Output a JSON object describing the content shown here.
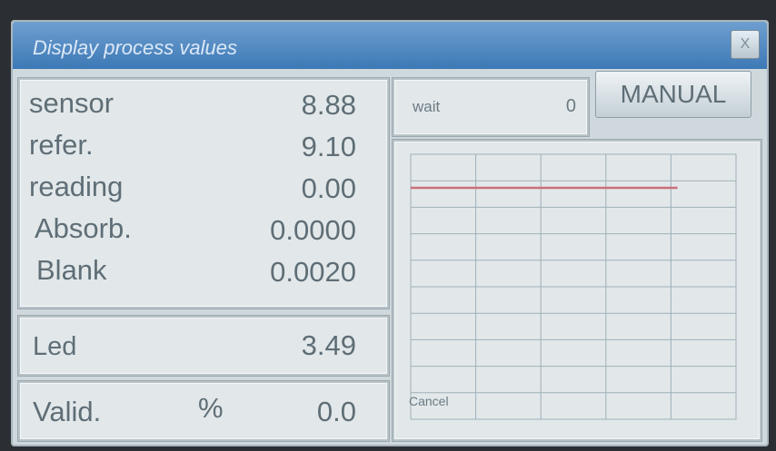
{
  "window": {
    "title": "Display process values",
    "close_label": "X"
  },
  "values": [
    {
      "label": "sensor",
      "value": "8.88"
    },
    {
      "label": "refer.",
      "value": "9.10"
    },
    {
      "label": "reading",
      "value": "0.00"
    },
    {
      "label": "Absorb.",
      "value": "0.0000"
    },
    {
      "label": "Blank",
      "value": "0.0020"
    }
  ],
  "led": {
    "label": "Led",
    "value": "3.49"
  },
  "valid": {
    "label": "Valid.",
    "unit": "%",
    "value": "0.0"
  },
  "wait": {
    "label": "wait",
    "value": "0"
  },
  "manual_button": "MANUAL",
  "chart": {
    "cancel_label": "Cancel",
    "line_color": "#c9707a",
    "grid_color": "#9fb0b8"
  }
}
